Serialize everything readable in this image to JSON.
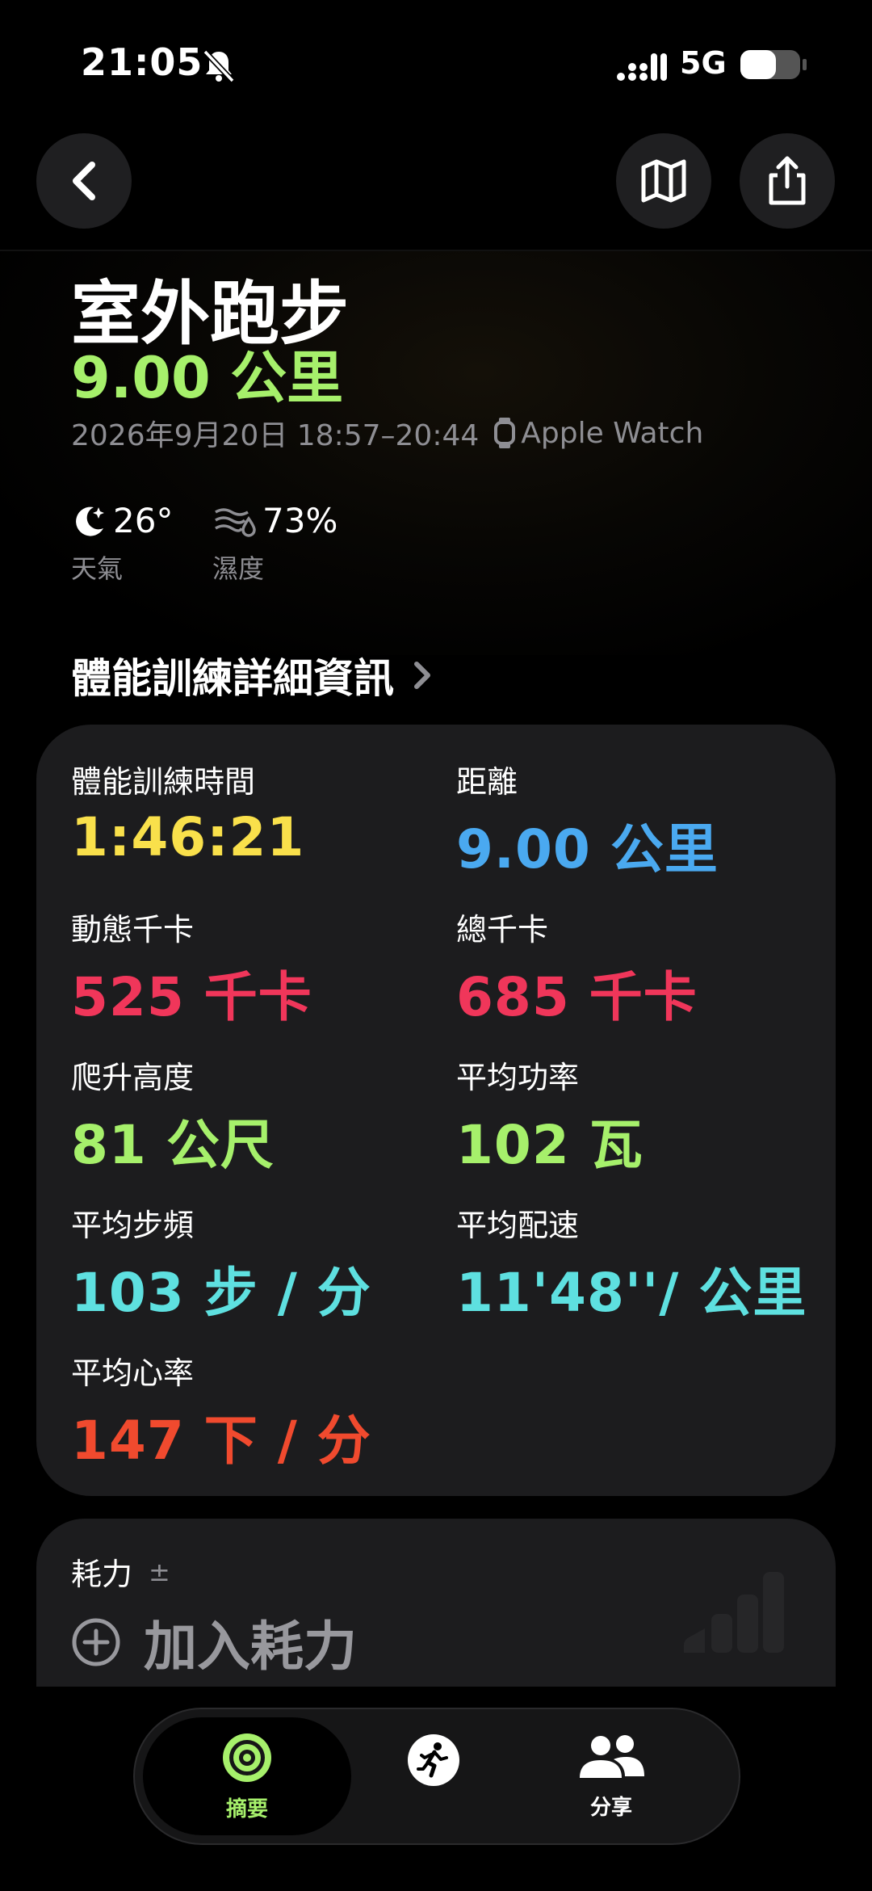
{
  "status_bar": {
    "time": "21:05",
    "network": "5G",
    "icons": [
      "bell-slash-icon",
      "signal-icon",
      "battery-icon"
    ]
  },
  "top_bar": {
    "icons": [
      "chevron-left-icon",
      "map-icon",
      "share-icon"
    ]
  },
  "header": {
    "title": "室外跑步",
    "distance": "9.00 公里",
    "date_time": "2026年9月20日 18:57–20:44",
    "device": "Apple Watch"
  },
  "weather": {
    "temperature": "26°",
    "temperature_label": "天氣",
    "humidity": "73%",
    "humidity_label": "濕度",
    "icons": [
      "moon-icon",
      "humidity-icon"
    ]
  },
  "details": {
    "section_title": "體能訓練詳細資訊",
    "metrics": [
      {
        "label": "體能訓練時間",
        "value": "1:46:21",
        "color": "#f9e04b"
      },
      {
        "label": "距離",
        "value": "9.00 公里",
        "color": "#4aa9f0"
      },
      {
        "label": "動態千卡",
        "value": "525 千卡",
        "color": "#f0365a"
      },
      {
        "label": "總千卡",
        "value": "685 千卡",
        "color": "#f0365a"
      },
      {
        "label": "爬升高度",
        "value": "81 公尺",
        "color": "#a6f06b"
      },
      {
        "label": "平均功率",
        "value": "102 瓦",
        "color": "#a6f06b"
      },
      {
        "label": "平均步頻",
        "value": "103 步 / 分",
        "color": "#5ee0e0"
      },
      {
        "label": "平均配速",
        "value": "11'48''/ 公里",
        "color": "#5ee0e0"
      },
      {
        "label": "平均心率",
        "value": "147 下 / 分",
        "color": "#f04a2e"
      }
    ]
  },
  "effort": {
    "label": "耗力",
    "pm_symbol": "±",
    "add_label": "加入耗力"
  },
  "tabbar": {
    "tabs": [
      {
        "label": "摘要",
        "icon": "activity-rings-icon",
        "active": true
      },
      {
        "label": "",
        "icon": "running-figure-icon",
        "active": false
      },
      {
        "label": "分享",
        "icon": "people-icon",
        "active": false
      }
    ]
  },
  "colors": {
    "accent_green": "#a6f06b",
    "card_bg": "#1c1c1e",
    "secondary_text": "#8e8e93"
  }
}
